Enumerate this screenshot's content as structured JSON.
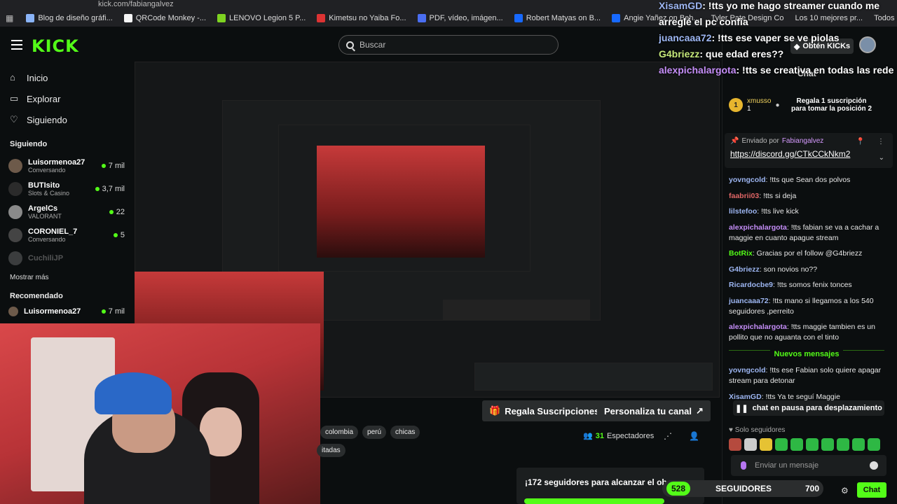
{
  "browser": {
    "url": "kick.com/fabiangalvez",
    "bookmarks": [
      "Blog de diseño gráfi...",
      "QRCode Monkey -...",
      "LENOVO Legion 5 P...",
      "Kimetsu no Yaiba Fo...",
      "PDF, vídeo, imágen...",
      "Robert Matyas on B...",
      "Angie Yañez on Beh...",
      "Tyler Pate Design Co",
      "Los 10 mejores pr..."
    ],
    "all_bookmarks": "Todos los marcadores"
  },
  "header": {
    "logo": "KICK",
    "search_placeholder": "Buscar",
    "kicks_button": "Obtén KICKs"
  },
  "sidebar": {
    "nav": [
      {
        "label": "Inicio",
        "icon": "home-icon"
      },
      {
        "label": "Explorar",
        "icon": "browse-icon"
      },
      {
        "label": "Siguiendo",
        "icon": "heart-icon"
      }
    ],
    "following_heading": "Siguiendo",
    "channels": [
      {
        "name": "Luisormenoa27",
        "category": "Conversando",
        "viewers": "7 mil"
      },
      {
        "name": "BUTIsito",
        "category": "Slots & Casino",
        "viewers": "3,7 mil"
      },
      {
        "name": "ArgelCs",
        "category": "VALORANT",
        "viewers": "22"
      },
      {
        "name": "CORONIEL_7",
        "category": "Conversando",
        "viewers": "5"
      },
      {
        "name": "CuchiliJP",
        "category": "",
        "viewers": ""
      }
    ],
    "show_more": "Mostrar más",
    "recommended_heading": "Recomendado",
    "recommended_first": "Luisormenoa27",
    "recommended_viewers": "7 mil"
  },
  "stream": {
    "tags": [
      "colombia",
      "perú",
      "chicas",
      "itadas"
    ],
    "gift_button": "Regala Suscripciones",
    "customize_button": "Personaliza tu canal",
    "viewers": "31",
    "viewers_label": "Espectadores",
    "goal_text": "¡172 seguidores para alcanzar el ob",
    "followers_current": "528",
    "followers_label": "SEGUIDORES",
    "followers_goal": "700"
  },
  "overlay": [
    {
      "user": "XisamGD",
      "text": ": !tts yo me hago streamer cuando me",
      "color": "blue"
    },
    {
      "user": "",
      "text": "arreglé el pc confia",
      "color": "none"
    },
    {
      "user": "juancaaa72",
      "text": ": !tts ese vaper se ve piolas",
      "color": "blue"
    },
    {
      "user": "G4briezz",
      "text": ": que edad eres??",
      "color": "green"
    },
    {
      "user": "alexpichalargota",
      "text": ": !tts se creativa en todas las rede",
      "color": "purple"
    }
  ],
  "chat": {
    "title": "Chat",
    "gift": {
      "rank": "1",
      "user": "xmusso",
      "count": "1",
      "text": "Regala 1 suscripción para tomar la posición 2"
    },
    "pinned": {
      "sent_by": "Enviado por",
      "user": "Fabiangalvez",
      "link": "https://discord.gg/CTkCCkNkm2"
    },
    "messages": [
      {
        "user": "yovngcold",
        "text": ": !tts que Sean dos polvos",
        "color": "#9db6f2"
      },
      {
        "user": "faabrii03",
        "text": ": !tts si deja",
        "color": "#e06666"
      },
      {
        "user": "lilstefoo",
        "text": ": !tts live kick",
        "color": "#9db6f2"
      },
      {
        "user": "alexpichalargota",
        "text": ": !tts fabian se va a cachar a maggie en cuanto apague stream",
        "color": "#c58ef8"
      },
      {
        "user": "BotRix",
        "text": ": Gracias por el follow @G4briezz",
        "color": "#53fc18"
      },
      {
        "user": "G4briezz",
        "text": ": son novios no??",
        "color": "#9db6f2"
      },
      {
        "user": "Ricardocbe9",
        "text": ": !tts somos fenix tonces",
        "color": "#9db6f2"
      },
      {
        "user": "juancaaa72",
        "text": ": !tts mano si llegamos a los 540 seguidores ,perreito",
        "color": "#9db6f2"
      },
      {
        "user": "alexpichalargota",
        "text": ": !tts maggie tambien es un pollito que no aguanta con el tinto",
        "color": "#c58ef8"
      }
    ],
    "new_messages": "Nuevos mensajes",
    "messages_after": [
      {
        "user": "yovngcold",
        "text": ": !tts ese Fabian solo quiere apagar stream para detonar",
        "color": "#9db6f2"
      },
      {
        "user": "XisamGD",
        "text": ": !tts Ya te seguí Maggie",
        "color": "#9db6f2"
      }
    ],
    "paused": "chat en pausa para desplazamiento",
    "followers_only": "Solo seguidores",
    "input_placeholder": "Enviar un mensaje",
    "send_button": "Chat"
  },
  "colors": {
    "accent": "#53fc18",
    "bg": "#0b0e0f"
  }
}
